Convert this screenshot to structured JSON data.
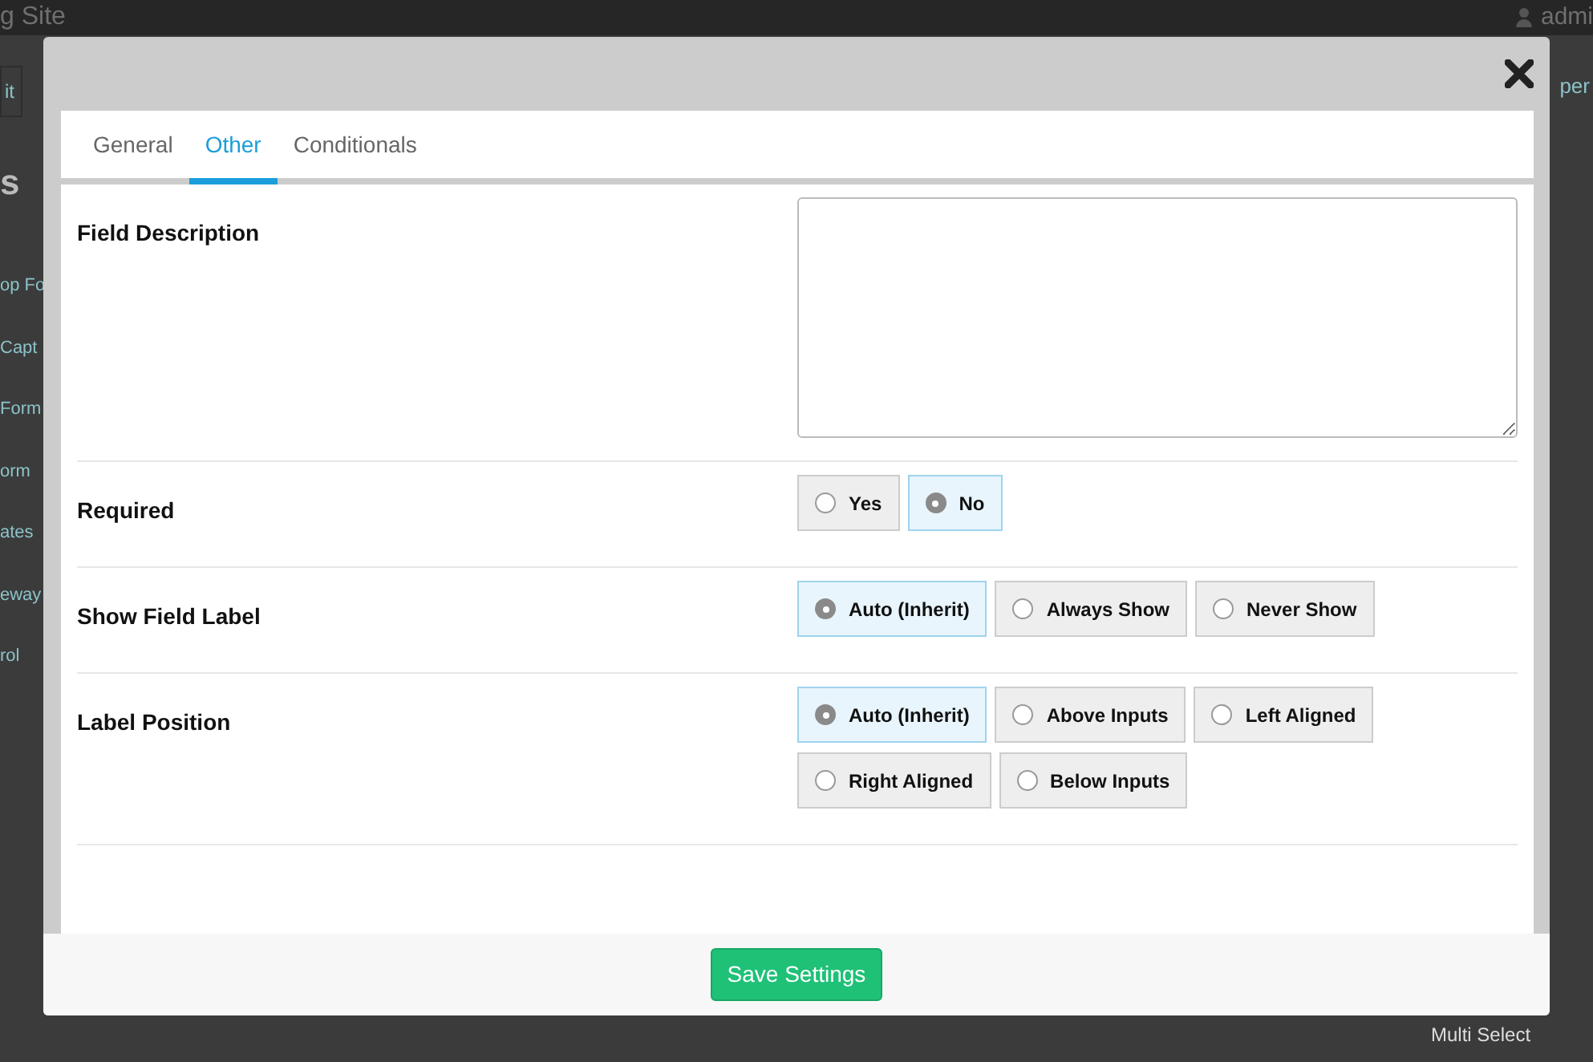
{
  "background": {
    "site_title": "g Site",
    "user": "admi",
    "sidebar_items": [
      {
        "text": "it",
        "kind": "button"
      },
      {
        "text": "s",
        "kind": "heading"
      },
      {
        "text": "op Fo",
        "kind": "link"
      },
      {
        "text": "Capt",
        "kind": "link"
      },
      {
        "text": "Form",
        "kind": "link"
      },
      {
        "text": "orm",
        "kind": "link"
      },
      {
        "text": "ates",
        "kind": "link"
      },
      {
        "text": "eway",
        "kind": "link"
      },
      {
        "text": "rol",
        "kind": "link"
      }
    ],
    "right_link": "per",
    "field_item": "Multi Select"
  },
  "modal": {
    "tabs": [
      {
        "label": "General",
        "selected": false
      },
      {
        "label": "Other",
        "selected": true
      },
      {
        "label": "Conditionals",
        "selected": false
      }
    ],
    "fields": [
      {
        "label": "Field Description",
        "kind": "textarea"
      },
      {
        "label": "Required",
        "kind": "radio",
        "options": [
          {
            "label": "Yes",
            "selected": false
          },
          {
            "label": "No",
            "selected": true
          }
        ]
      },
      {
        "label": "Show Field Label",
        "kind": "radio",
        "options": [
          {
            "label": "Auto (Inherit)",
            "selected": true
          },
          {
            "label": "Always Show",
            "selected": false
          },
          {
            "label": "Never Show",
            "selected": false
          }
        ]
      },
      {
        "label": "Label Position",
        "kind": "radio",
        "options": [
          {
            "label": "Auto (Inherit)",
            "selected": true
          },
          {
            "label": "Above Inputs",
            "selected": false
          },
          {
            "label": "Left Aligned",
            "selected": false
          },
          {
            "label": "Right Aligned",
            "selected": false
          },
          {
            "label": "Below Inputs",
            "selected": false
          }
        ]
      }
    ],
    "save_button": "Save Settings"
  }
}
